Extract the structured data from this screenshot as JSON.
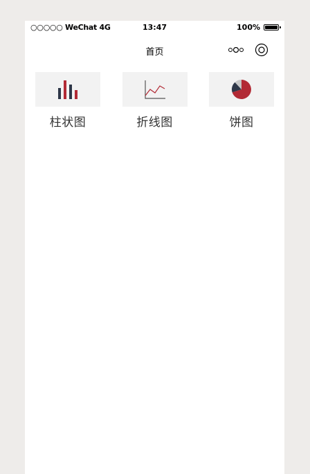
{
  "status_bar": {
    "carrier": "○○○○○ WeChat 4G",
    "time": "13:47",
    "battery_percent": "100%"
  },
  "nav": {
    "title": "首页"
  },
  "grid": {
    "items": [
      {
        "label": "柱状图",
        "icon": "bar-chart-icon"
      },
      {
        "label": "折线图",
        "icon": "line-chart-icon"
      },
      {
        "label": "饼图",
        "icon": "pie-chart-icon"
      }
    ]
  },
  "colors": {
    "accent_red": "#b22a35",
    "dark_navy": "#2e3748",
    "tile_bg": "#f2f2f2",
    "page_bg": "#eeecea"
  }
}
